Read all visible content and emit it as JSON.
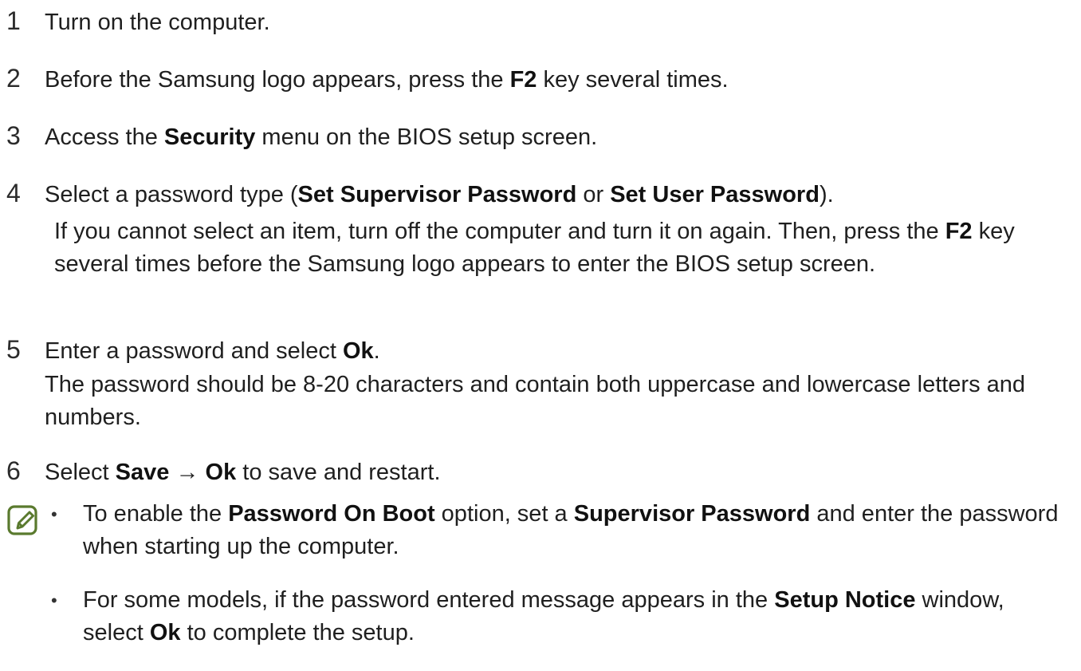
{
  "steps": [
    {
      "num": "1",
      "parts": [
        {
          "t": "Turn on the computer."
        }
      ]
    },
    {
      "num": "2",
      "parts": [
        {
          "t": "Before the Samsung logo appears, press the "
        },
        {
          "t": "F2",
          "b": true
        },
        {
          "t": " key several times."
        }
      ]
    },
    {
      "num": "3",
      "parts": [
        {
          "t": "Access the "
        },
        {
          "t": "Security",
          "b": true
        },
        {
          "t": " menu on the BIOS setup screen."
        }
      ]
    },
    {
      "num": "4",
      "parts": [
        {
          "t": "Select a password type ("
        },
        {
          "t": "Set Supervisor Password",
          "b": true
        },
        {
          "t": " or "
        },
        {
          "t": "Set User Password",
          "b": true
        },
        {
          "t": ")."
        }
      ]
    },
    {
      "num": "5",
      "parts": [
        {
          "t": "Enter a password and select "
        },
        {
          "t": "Ok",
          "b": true
        },
        {
          "t": "."
        }
      ]
    },
    {
      "num": "6",
      "parts": [
        {
          "t": "Select "
        },
        {
          "t": "Save",
          "b": true
        },
        {
          "t": " → "
        },
        {
          "t": "Ok",
          "b": true
        },
        {
          "t": " to save and restart."
        }
      ]
    }
  ],
  "step4_note": [
    {
      "t": "If you cannot select an item, turn off the computer and turn it on again. Then, press the "
    },
    {
      "t": "F2",
      "b": true
    },
    {
      "t": " key several times before the Samsung logo appears to enter the BIOS setup screen."
    }
  ],
  "step5_note": [
    {
      "t": "The password should be 8-20 characters and contain both uppercase and lowercase letters and numbers."
    }
  ],
  "notes": {
    "icon": "note-pencil-icon",
    "icon_color": "#5a7a2e",
    "bullets": [
      [
        {
          "t": "To enable the "
        },
        {
          "t": "Password On Boot",
          "b": true
        },
        {
          "t": " option, set a "
        },
        {
          "t": "Supervisor Password",
          "b": true
        },
        {
          "t": " and enter the password when starting up the computer."
        }
      ],
      [
        {
          "t": "For some models, if the password entered message appears in the "
        },
        {
          "t": "Setup Notice",
          "b": true
        },
        {
          "t": " window, select "
        },
        {
          "t": "Ok",
          "b": true
        },
        {
          "t": " to complete the setup."
        }
      ]
    ],
    "bullet_char": "•"
  }
}
